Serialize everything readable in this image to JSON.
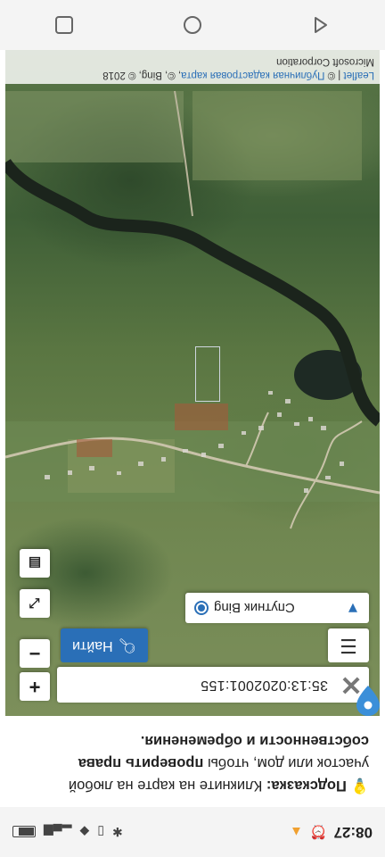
{
  "status_bar": {
    "time": "08:27",
    "alarm_icon": "alarm-icon",
    "battery_icon": "battery-icon"
  },
  "hint": {
    "emoji": "💡",
    "label": "Подсказка:",
    "text_1": " Кликните на карте на любой участок или дом, чтобы ",
    "link": "проверить права",
    "text_2": " собственности и обременения."
  },
  "search": {
    "value": "35:13:0202001:155",
    "clear_icon": "close-icon"
  },
  "buttons": {
    "find_label": "Найти",
    "menu_icon": "menu-icon",
    "zoom_in": "+",
    "zoom_out": "−",
    "fullscreen_icon": "fullscreen-icon",
    "print_icon": "print-icon"
  },
  "layer": {
    "label": "Спутник Bing",
    "selected": true
  },
  "attribution": {
    "leaflet": "Leaflet",
    "sep": " | © ",
    "cadastral": "Публичная кадастровая карта",
    "rest": ", ©, Bing, © 2018",
    "ms": "Microsoft Corporation"
  },
  "nav": {
    "back_icon": "back-icon",
    "home_icon": "home-icon",
    "recents_icon": "recents-icon"
  },
  "colors": {
    "accent": "#2a6fb7",
    "river": "#1d2a1e",
    "map_green": "#5a7642"
  }
}
